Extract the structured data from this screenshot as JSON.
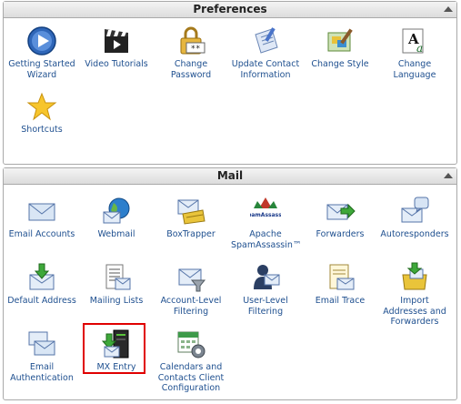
{
  "preferences": {
    "title": "Preferences",
    "items": [
      {
        "id": "getting-started-wizard",
        "label": "Getting Started Wizard",
        "icon": "play-circle-icon"
      },
      {
        "id": "video-tutorials",
        "label": "Video Tutorials",
        "icon": "video-clapper-icon"
      },
      {
        "id": "change-password",
        "label": "Change Password",
        "icon": "padlock-password-icon"
      },
      {
        "id": "update-contact-information",
        "label": "Update Contact Information",
        "icon": "contact-card-icon"
      },
      {
        "id": "change-style",
        "label": "Change Style",
        "icon": "paint-style-icon"
      },
      {
        "id": "change-language",
        "label": "Change Language",
        "icon": "language-letters-icon"
      },
      {
        "id": "shortcuts",
        "label": "Shortcuts",
        "icon": "star-icon"
      }
    ]
  },
  "mail": {
    "title": "Mail",
    "items": [
      {
        "id": "email-accounts",
        "label": "Email Accounts",
        "icon": "envelope-icon"
      },
      {
        "id": "webmail",
        "label": "Webmail",
        "icon": "globe-envelope-icon"
      },
      {
        "id": "boxtrapper",
        "label": "BoxTrapper",
        "icon": "envelope-trap-icon"
      },
      {
        "id": "apache-spamassassin",
        "label": "Apache SpamAssassin™",
        "icon": "spamassassin-logo-icon"
      },
      {
        "id": "forwarders",
        "label": "Forwarders",
        "icon": "envelope-forward-icon"
      },
      {
        "id": "autoresponders",
        "label": "Autoresponders",
        "icon": "envelope-reply-icon"
      },
      {
        "id": "default-address",
        "label": "Default Address",
        "icon": "envelope-download-icon"
      },
      {
        "id": "mailing-lists",
        "label": "Mailing Lists",
        "icon": "mailing-list-icon"
      },
      {
        "id": "account-level-filtering",
        "label": "Account-Level Filtering",
        "icon": "envelope-filter-icon"
      },
      {
        "id": "user-level-filtering",
        "label": "User-Level Filtering",
        "icon": "user-filter-icon"
      },
      {
        "id": "email-trace",
        "label": "Email Trace",
        "icon": "envelope-trace-icon"
      },
      {
        "id": "import-addresses",
        "label": "Import Addresses and Forwarders",
        "icon": "import-box-icon"
      },
      {
        "id": "email-authentication",
        "label": "Email Authentication",
        "icon": "envelope-auth-icon"
      },
      {
        "id": "mx-entry",
        "label": "MX Entry",
        "icon": "mx-server-icon"
      },
      {
        "id": "calendars-contacts",
        "label": "Calendars and Contacts Client Configuration",
        "icon": "calendar-gear-icon"
      }
    ]
  },
  "colors": {
    "highlight": "#e00000",
    "link": "#1e4f8f"
  }
}
